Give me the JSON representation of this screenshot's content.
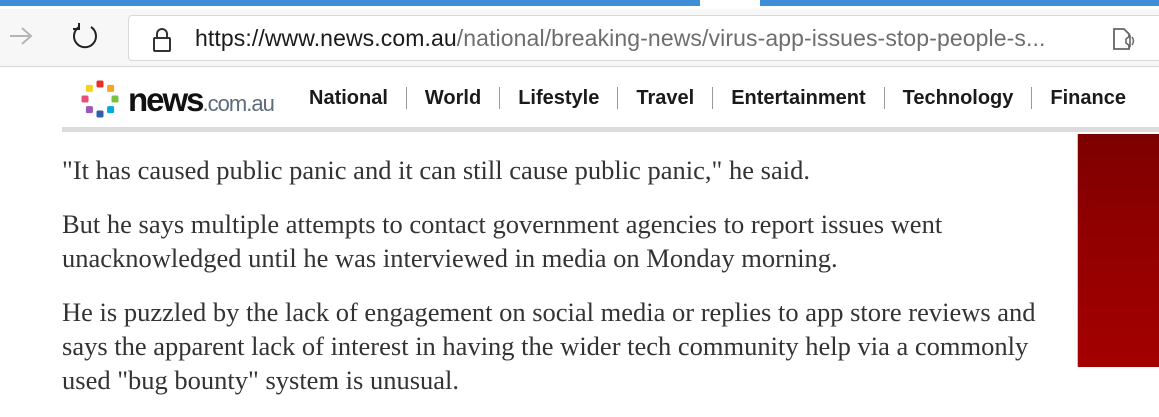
{
  "browser": {
    "url_host": "https://www.news.com.au",
    "url_path": "/national/breaking-news/virus-app-issues-stop-people-s...",
    "icons": {
      "forward": "arrow-right-icon",
      "refresh": "refresh-icon",
      "lock": "lock-icon",
      "reader": "read-aloud-icon"
    },
    "colors": {
      "tab_accent": "#3f8fd8"
    }
  },
  "site": {
    "logo_word": "news",
    "logo_domain": ".com.au",
    "logo_dot_colors": [
      "#e8302a",
      "#f5a623",
      "#7ac143",
      "#00a9e0",
      "#2e5fa8",
      "#9b59b6",
      "#e94e77",
      "#f7d117"
    ],
    "nav": [
      {
        "label": "National"
      },
      {
        "label": "World"
      },
      {
        "label": "Lifestyle"
      },
      {
        "label": "Travel"
      },
      {
        "label": "Entertainment"
      },
      {
        "label": "Technology"
      },
      {
        "label": "Finance"
      }
    ]
  },
  "article": {
    "paragraphs": [
      "\"It has caused public panic and it can still cause public panic,\" he said.",
      "But he says multiple attempts to contact government agencies to report issues went unacknowledged until he was interviewed in media on Monday morning.",
      "He is puzzled by the lack of engagement on social media or replies to app store reviews and says the apparent lack of interest in having the wider tech community help via a commonly used \"bug bounty\" system is unusual."
    ]
  },
  "ad": {
    "color": "#900000"
  }
}
